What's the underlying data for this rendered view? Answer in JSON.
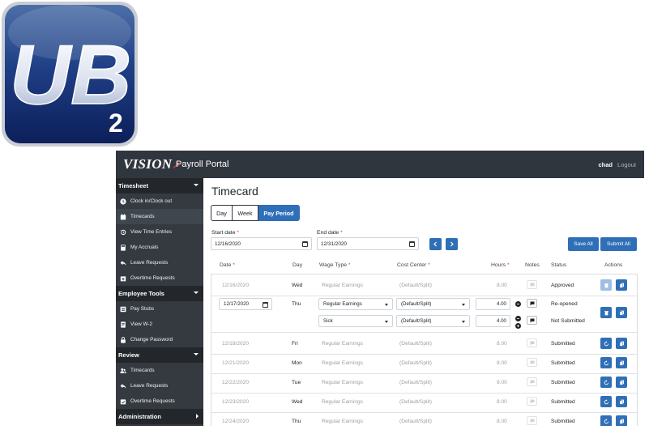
{
  "logo": {
    "letters": "UB",
    "subscript": "2"
  },
  "topbar": {
    "brand_logo": "VISION",
    "brand_title": "Payroll Portal",
    "user": "chad",
    "logout": "Logout"
  },
  "sidebar": {
    "sections": [
      {
        "title": "Timesheet",
        "items": [
          {
            "label": "Clock in/Clock out",
            "icon": "clock-icon"
          },
          {
            "label": "Timecards",
            "icon": "calendar-icon"
          },
          {
            "label": "View Time Entries",
            "icon": "history-icon"
          },
          {
            "label": "My Accruals",
            "icon": "calculator-icon"
          },
          {
            "label": "Leave Requests",
            "icon": "reply-arrow-icon"
          },
          {
            "label": "Overtime Requests",
            "icon": "calendar-plus-icon"
          }
        ]
      },
      {
        "title": "Employee Tools",
        "items": [
          {
            "label": "Pay Stubs",
            "icon": "list-icon"
          },
          {
            "label": "View W-2",
            "icon": "document-icon"
          },
          {
            "label": "Change Password",
            "icon": "lock-icon"
          }
        ]
      },
      {
        "title": "Review",
        "items": [
          {
            "label": "Timecards",
            "icon": "users-icon"
          },
          {
            "label": "Leave Requests",
            "icon": "reply-arrow-icon"
          },
          {
            "label": "Overtime Requests",
            "icon": "calendar-plus-icon"
          }
        ]
      },
      {
        "title": "Administration",
        "items": []
      }
    ]
  },
  "main": {
    "title": "Timecard",
    "views": {
      "day": "Day",
      "week": "Week",
      "pay_period": "Pay Period"
    },
    "start_label": "Start date",
    "end_label": "End date",
    "required_mark": "*",
    "start_date": "12/16/2020",
    "end_date": "12/31/2020",
    "save_all": "Save All",
    "submit_all": "Submit All",
    "headers": {
      "date": "Date",
      "day": "Day",
      "wage_type": "Wage Type",
      "cost_center": "Cost Center",
      "hours": "Hours",
      "notes": "Notes",
      "status": "Status",
      "actions": "Actions"
    },
    "rows": [
      {
        "date": "12/16/2020",
        "day": "Wed",
        "wage": "Regular Earnings",
        "cost": "(Default/Split)",
        "hours": "8.00",
        "status": "Approved"
      },
      {
        "date": "12/17/2020",
        "day": "Thu",
        "wage": "Regular Earnings",
        "cost": "(Default/Split)",
        "hours": "4.00",
        "status": "Re-opened",
        "wage2": "Sick",
        "cost2": "(Default/Split)",
        "hours2": "4.00",
        "status2": "Not Submitted"
      },
      {
        "date": "12/18/2020",
        "day": "Fri",
        "wage": "Regular Earnings",
        "cost": "(Default/Split)",
        "hours": "8.00",
        "status": "Submitted"
      },
      {
        "date": "12/21/2020",
        "day": "Mon",
        "wage": "Regular Earnings",
        "cost": "(Default/Split)",
        "hours": "8.00",
        "status": "Submitted"
      },
      {
        "date": "12/22/2020",
        "day": "Tue",
        "wage": "Regular Earnings",
        "cost": "(Default/Split)",
        "hours": "8.00",
        "status": "Submitted"
      },
      {
        "date": "12/23/2020",
        "day": "Wed",
        "wage": "Regular Earnings",
        "cost": "(Default/Split)",
        "hours": "8.00",
        "status": "Submitted"
      },
      {
        "date": "12/24/2020",
        "day": "Thu",
        "wage": "Regular Earnings",
        "cost": "(Default/Split)",
        "hours": "8.00",
        "status": "Submitted"
      }
    ]
  },
  "colors": {
    "topbar": "#30363e",
    "sidebar": "#343a40",
    "accent": "#2f6fb7",
    "required": "#d6393a"
  }
}
